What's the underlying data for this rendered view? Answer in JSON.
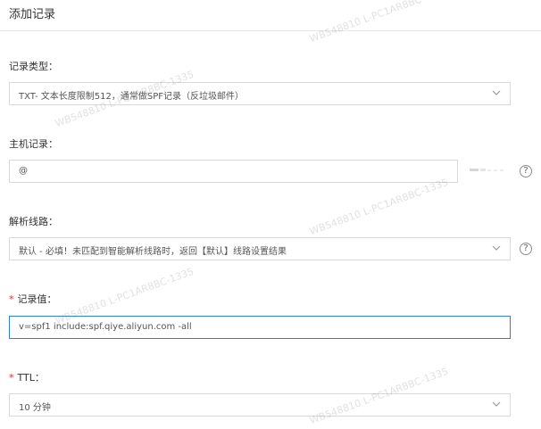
{
  "header": {
    "title": "添加记录"
  },
  "form": {
    "record_type": {
      "label": "记录类型：",
      "value": "TXT- 文本长度限制512，通常做SPF记录（反垃圾邮件）"
    },
    "host_record": {
      "label": "主机记录：",
      "value": "@"
    },
    "resolution_line": {
      "label": "解析线路：",
      "value": "默认 - 必填！未匹配到智能解析线路时，返回【默认】线路设置结果"
    },
    "record_value": {
      "required_mark": "*",
      "label": "记录值：",
      "value": "v=spf1 include:spf.qiye.aliyun.com -all"
    },
    "ttl": {
      "required_mark": "*",
      "label": "TTL：",
      "value": "10 分钟"
    },
    "help_glyph": "?"
  },
  "watermark": {
    "text": "WB548810 L-PC1AR8BC-1335"
  },
  "colors": {
    "focus_border": "#2f7fd6",
    "required": "#e62e2e",
    "border": "#d9d9d9"
  },
  "icons": {
    "dropdown": "chevron-down-icon",
    "help": "question-circle-icon"
  }
}
